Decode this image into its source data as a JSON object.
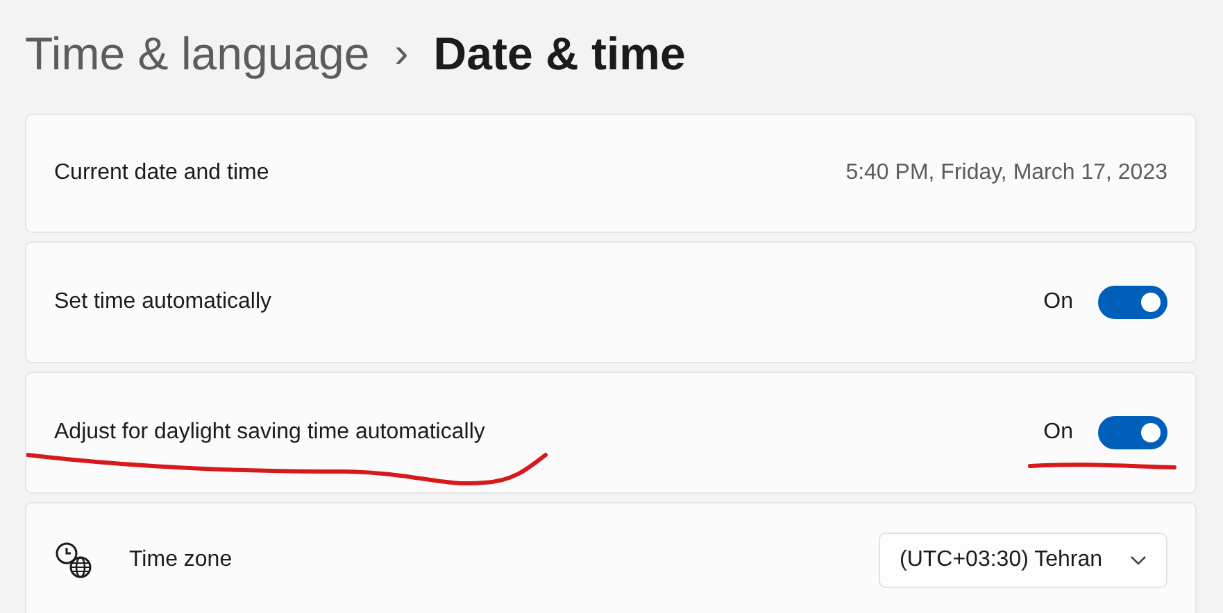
{
  "breadcrumb": {
    "parent": "Time & language",
    "separator": "›",
    "current": "Date & time"
  },
  "rows": [
    {
      "kind": "value",
      "label": "Current date and time",
      "value": "5:40 PM, Friday, March 17, 2023",
      "annotated": false
    },
    {
      "kind": "toggle",
      "label": "Set time automatically",
      "state_text": "On",
      "on": true,
      "annotated": false
    },
    {
      "kind": "toggle",
      "label": "Adjust for daylight saving time automatically",
      "state_text": "On",
      "on": true,
      "annotated": true
    },
    {
      "kind": "dropdown",
      "label": "Time zone",
      "value": "(UTC+03:30) Tehran",
      "annotated": false
    }
  ]
}
